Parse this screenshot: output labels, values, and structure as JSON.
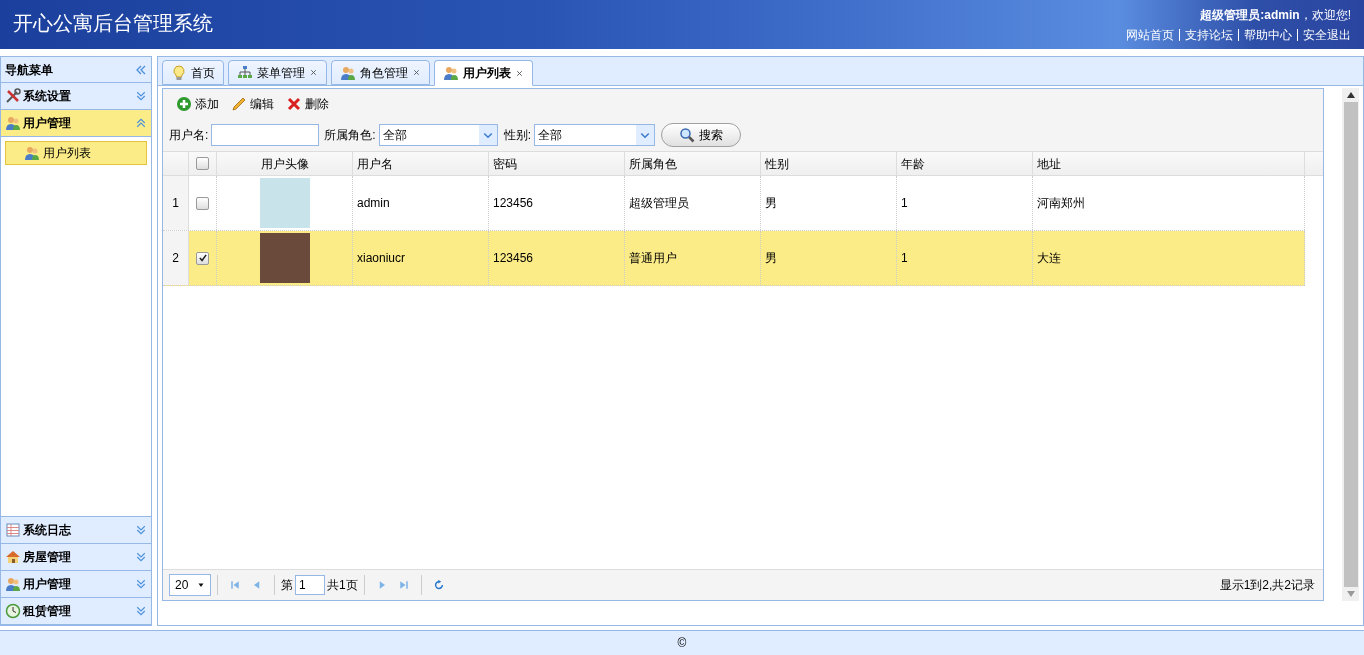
{
  "header": {
    "title": "开心公寓后台管理系统",
    "welcome": "**超级管理员:admin**，欢迎您!",
    "links": [
      "网站首页",
      "支持论坛",
      "帮助中心",
      "安全退出"
    ]
  },
  "sidebar": {
    "title": "导航菜单",
    "top_sections": [
      {
        "label": "系统设置",
        "kind": "tools",
        "expanded": false
      },
      {
        "label": "用户管理",
        "kind": "users",
        "expanded": true,
        "children": [
          {
            "label": "用户列表",
            "selected": true
          }
        ]
      }
    ],
    "bottom_sections": [
      {
        "label": "系统日志",
        "kind": "log",
        "expanded": false
      },
      {
        "label": "房屋管理",
        "kind": "house",
        "expanded": false
      },
      {
        "label": "用户管理",
        "kind": "users",
        "expanded": false
      },
      {
        "label": "租赁管理",
        "kind": "clock",
        "expanded": false
      }
    ]
  },
  "tabs": [
    {
      "label": "首页",
      "kind": "bulb",
      "selected": false,
      "closable": false
    },
    {
      "label": "菜单管理",
      "kind": "tree",
      "selected": false,
      "closable": true
    },
    {
      "label": "角色管理",
      "kind": "users",
      "selected": false,
      "closable": true
    },
    {
      "label": "用户列表",
      "kind": "users",
      "selected": true,
      "closable": true
    }
  ],
  "toolbar": [
    {
      "label": "添加",
      "kind": "add"
    },
    {
      "label": "编辑",
      "kind": "edit"
    },
    {
      "label": "删除",
      "kind": "delete"
    }
  ],
  "filters": {
    "username_label": "用户名:",
    "role_label": "所属角色:",
    "role_value": "全部",
    "gender_label": "性别:",
    "gender_value": "全部",
    "search_button": "搜索"
  },
  "table": {
    "select_all_checked": false,
    "columns": [
      "用户头像",
      "用户名",
      "密码",
      "所属角色",
      "性别",
      "年龄",
      "地址"
    ],
    "rows": [
      {
        "number": "1",
        "checked": false,
        "selected": false,
        "username": "admin",
        "password": "123456",
        "role": "超级管理员",
        "gender": "男",
        "age": "1",
        "address": "河南郑州"
      },
      {
        "number": "2",
        "checked": true,
        "selected": true,
        "username": "xiaoniucr",
        "password": "123456",
        "role": "普通用户",
        "gender": "男",
        "age": "1",
        "address": "大连"
      }
    ]
  },
  "pager": {
    "page_size": "20",
    "page_prefix": "第",
    "page_value": "1",
    "page_total": "共1页",
    "summary": "显示1到2,共2记录"
  },
  "footer": {
    "text": "©"
  }
}
